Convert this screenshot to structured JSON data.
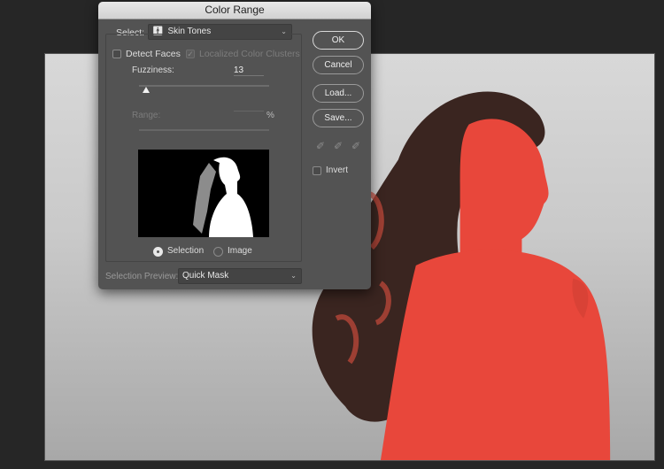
{
  "dialog": {
    "title": "Color Range",
    "select_label": "Select:",
    "select_value": "Skin Tones",
    "select_icon": "person-icon",
    "detect_faces_label": "Detect Faces",
    "detect_faces_checked": false,
    "localized_label": "Localized Color Clusters",
    "localized_checked": true,
    "fuzziness_label": "Fuzziness:",
    "fuzziness_value": "13",
    "range_label": "Range:",
    "range_value": "",
    "range_unit": "%",
    "radio_selection_label": "Selection",
    "radio_image_label": "Image",
    "radio_selected": "Selection",
    "preview_mode_label": "Selection Preview:",
    "preview_mode_value": "Quick Mask",
    "buttons": {
      "ok": "OK",
      "cancel": "Cancel",
      "load": "Load...",
      "save": "Save..."
    },
    "eyedroppers": [
      "eyedropper-icon",
      "eyedropper-plus-icon",
      "eyedropper-minus-icon"
    ],
    "invert_label": "Invert",
    "invert_checked": false
  },
  "colors": {
    "mask_overlay": "#e8473b",
    "dialog_bg": "#535353",
    "workspace_bg": "#262626"
  }
}
